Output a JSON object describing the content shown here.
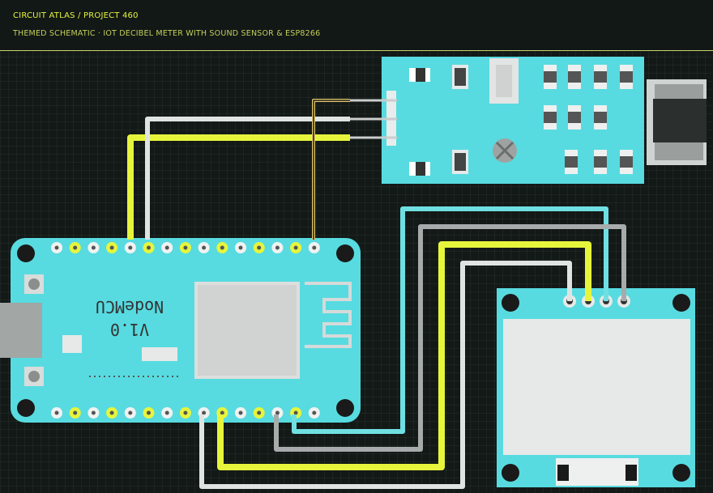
{
  "header": {
    "breadcrumb": "CIRCUIT ATLAS / PROJECT 460",
    "subtitle": "THEMED SCHEMATIC · IOT DECIBEL METER WITH SOUND SENSOR & ESP8266"
  },
  "nodemcu": {
    "title_line1": "V1.0",
    "title_line2": "NodeMCU",
    "color": "#57dbe0"
  },
  "colors": {
    "board": "#57dbe0",
    "wire_yellow": "#e6f53c",
    "wire_white": "#dfe4e3",
    "wire_gray": "#a7abab",
    "wire_cyan": "#6fdfe2",
    "header_line": "#c9d36a"
  }
}
